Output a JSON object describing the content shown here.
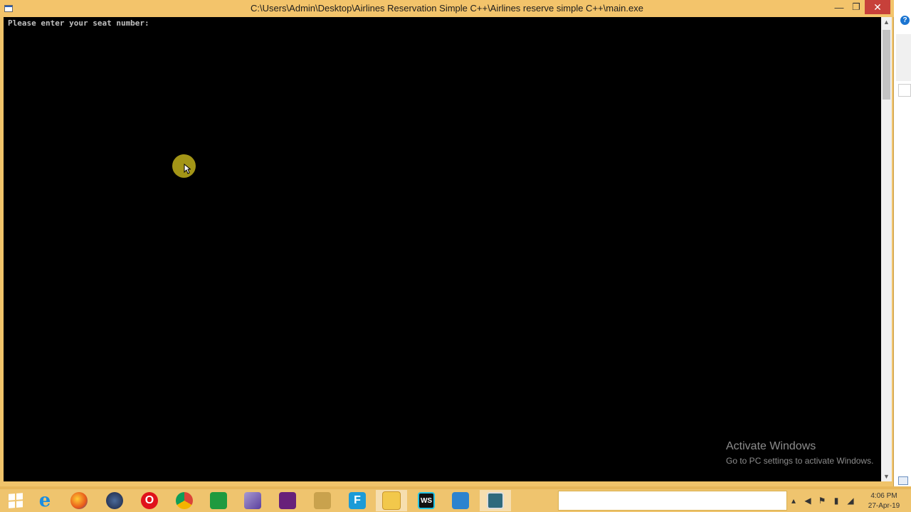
{
  "window": {
    "title": "C:\\Users\\Admin\\Desktop\\Airlines Reservation Simple C++\\Airlines reserve simple C++\\main.exe",
    "minimize_label": "—",
    "maximize_label": "❐",
    "close_label": "✕"
  },
  "console": {
    "output": "Please enter your seat number:"
  },
  "watermark": {
    "line1": "Activate Windows",
    "line2": "Go to PC settings to activate Windows."
  },
  "taskbar": {
    "items": [
      {
        "name": "start-button",
        "icon": "windows-logo-icon",
        "label": ""
      },
      {
        "name": "internet-explorer",
        "icon": "internet-explorer-icon",
        "label": "e"
      },
      {
        "name": "firefox",
        "icon": "firefox-icon",
        "label": ""
      },
      {
        "name": "eclipse",
        "icon": "eclipse-icon",
        "label": ""
      },
      {
        "name": "opera",
        "icon": "opera-icon",
        "label": "O"
      },
      {
        "name": "chrome",
        "icon": "chrome-icon",
        "label": ""
      },
      {
        "name": "store",
        "icon": "store-icon",
        "label": ""
      },
      {
        "name": "visual-studio-alt",
        "icon": "vs-purple-icon",
        "label": ""
      },
      {
        "name": "visual-studio",
        "icon": "visual-studio-icon",
        "label": ""
      },
      {
        "name": "tool",
        "icon": "tool-icon",
        "label": ""
      },
      {
        "name": "f-app",
        "icon": "f-app-icon",
        "label": "F"
      },
      {
        "name": "file-explorer",
        "icon": "folder-icon",
        "label": ""
      },
      {
        "name": "webstorm",
        "icon": "webstorm-icon",
        "label": "WS"
      },
      {
        "name": "vscode",
        "icon": "vscode-icon",
        "label": ""
      },
      {
        "name": "console-app",
        "icon": "console-window-icon",
        "label": ""
      }
    ],
    "clock": {
      "time": "4:06 PM",
      "date": "27-Apr-19"
    }
  }
}
